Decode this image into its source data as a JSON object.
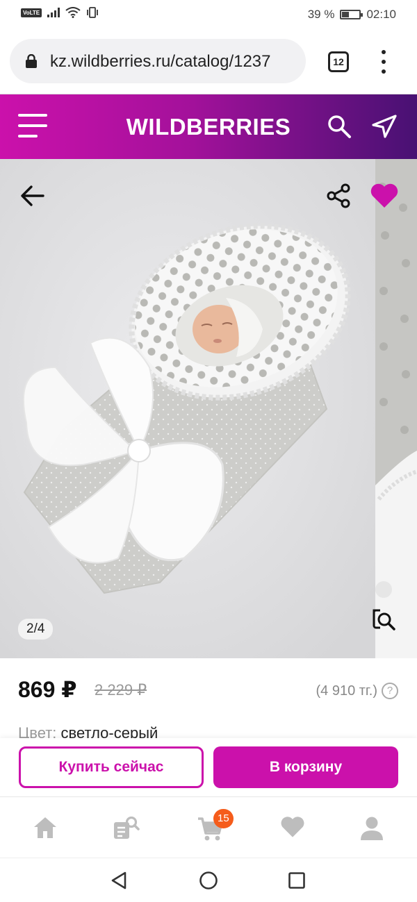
{
  "status_bar": {
    "volte": "VoLTE",
    "battery_percent": "39 %",
    "time": "02:10",
    "battery_level": 0.39
  },
  "browser": {
    "url": "kz.wildberries.ru/catalog/1237",
    "tab_count": "12",
    "icons": [
      "lock-icon",
      "tabs-icon",
      "more-vert-icon"
    ]
  },
  "header": {
    "logo": "WILDBERRIES",
    "colors": {
      "gradient_start": "#cb11ab",
      "gradient_end": "#481173"
    },
    "icons": [
      "menu-icon",
      "search-icon",
      "send-icon"
    ]
  },
  "gallery": {
    "counter": "2/4",
    "icons": [
      "arrow-left-icon",
      "share-icon",
      "heart-icon",
      "zoom-search-icon"
    ],
    "favorite_color": "#cb11ab"
  },
  "product": {
    "price": "869 ₽",
    "old_price": "2 229 ₽",
    "alt_price": "(4 910 тг.)",
    "help": "?",
    "color_label": "Цвет:",
    "color_value": "светло-серый"
  },
  "actions": {
    "buy_now": "Купить сейчас",
    "add_to_cart": "В корзину",
    "accent_color": "#cb11ab"
  },
  "bottom_nav": {
    "items": [
      "home-icon",
      "catalog-search-icon",
      "cart-icon",
      "favorites-icon",
      "profile-icon"
    ],
    "cart_badge": "15",
    "badge_color": "#f55c1b"
  },
  "system_nav": {
    "icons": [
      "back-triangle-icon",
      "home-circle-icon",
      "recents-square-icon"
    ]
  }
}
